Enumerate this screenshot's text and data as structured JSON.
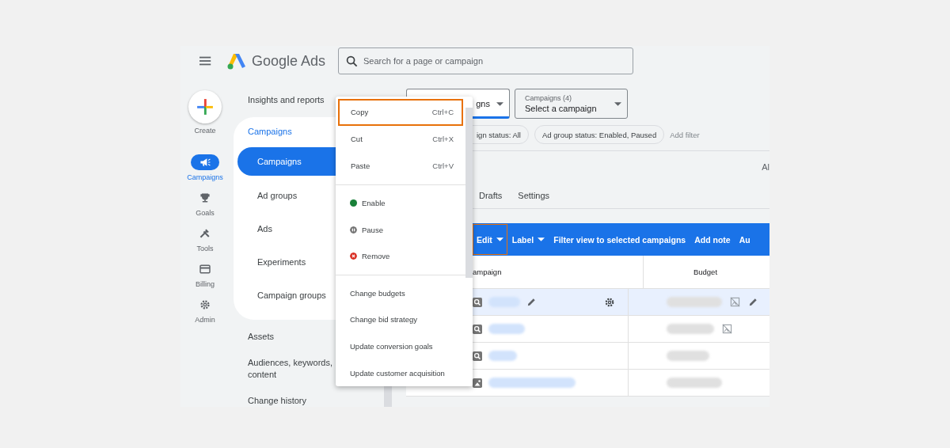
{
  "header": {
    "product": "Google Ads",
    "search": {
      "placeholder": "Search for a page or campaign"
    }
  },
  "rail": {
    "create": "Create",
    "items": [
      {
        "label": "Campaigns",
        "selected": true
      },
      {
        "label": "Goals",
        "selected": false
      },
      {
        "label": "Tools",
        "selected": false
      },
      {
        "label": "Billing",
        "selected": false
      },
      {
        "label": "Admin",
        "selected": false
      }
    ]
  },
  "nav": {
    "top": "Insights and reports",
    "group": {
      "title": "Campaigns",
      "items": [
        {
          "label": "Campaigns",
          "selected": true
        },
        {
          "label": "Ad groups",
          "selected": false
        },
        {
          "label": "Ads",
          "selected": false
        },
        {
          "label": "Experiments",
          "selected": false
        },
        {
          "label": "Campaign groups",
          "selected": false
        }
      ]
    },
    "after": [
      "Assets",
      "Audiences, keywords, content",
      "Change history"
    ]
  },
  "pickers": [
    {
      "value": "gns"
    },
    {
      "label": "Campaigns (4)",
      "value": "Select a campaign"
    }
  ],
  "filters": {
    "chips": [
      "ign status: All",
      "Ad group status: Enabled, Paused"
    ],
    "add": "Add filter"
  },
  "right_text": "Al",
  "tabs": [
    {
      "label": "Drafts",
      "selected": false
    },
    {
      "label": "Settings",
      "selected": false
    }
  ],
  "action_bar": [
    {
      "label": "Edit",
      "dropdown": true,
      "highlighted": true
    },
    {
      "label": "Label",
      "dropdown": true,
      "highlighted": false
    },
    {
      "label": "Filter view to selected campaigns",
      "dropdown": false,
      "highlighted": false
    },
    {
      "label": "Add note",
      "dropdown": false,
      "highlighted": false
    },
    {
      "label": "Au",
      "dropdown": false,
      "highlighted": false
    }
  ],
  "table": {
    "columns": [
      "ampaign",
      "Budget"
    ],
    "rows": [
      {
        "selected": true,
        "kind": "search",
        "budget_icon": true,
        "editable": true
      },
      {
        "selected": false,
        "kind": "search",
        "budget_icon": true,
        "editable": false
      },
      {
        "selected": false,
        "kind": "search",
        "budget_icon": false,
        "editable": false
      },
      {
        "selected": false,
        "kind": "display",
        "budget_icon": false,
        "editable": false
      }
    ]
  },
  "menu": {
    "items": [
      {
        "kind": "shortcut",
        "label": "Copy",
        "shortcut": "Ctrl+C",
        "highlighted": true
      },
      {
        "kind": "shortcut",
        "label": "Cut",
        "shortcut": "Ctrl+X",
        "highlighted": false
      },
      {
        "kind": "shortcut",
        "label": "Paste",
        "shortcut": "Ctrl+V",
        "highlighted": false
      },
      {
        "kind": "divider"
      },
      {
        "kind": "enable",
        "label": "Enable"
      },
      {
        "kind": "pause",
        "label": "Pause"
      },
      {
        "kind": "remove",
        "label": "Remove"
      },
      {
        "kind": "divider"
      },
      {
        "kind": "plain",
        "label": "Change budgets"
      },
      {
        "kind": "plain",
        "label": "Change bid strategy"
      },
      {
        "kind": "plain",
        "label": "Update conversion goals"
      },
      {
        "kind": "plain",
        "label": "Update customer acquisition"
      }
    ]
  }
}
